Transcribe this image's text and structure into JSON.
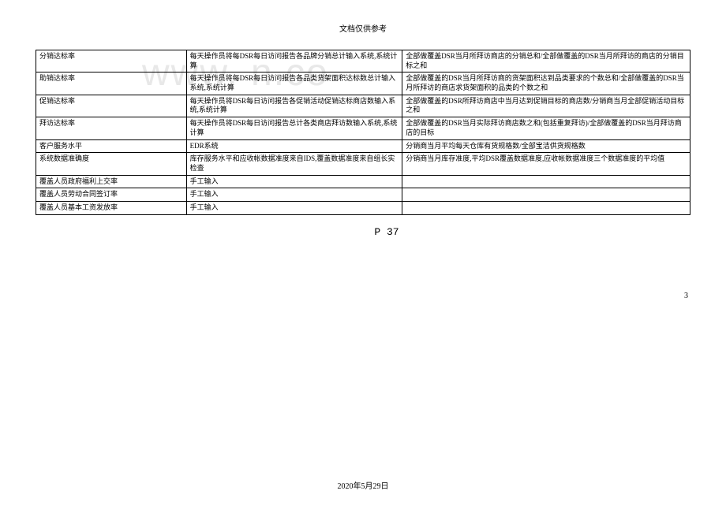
{
  "header": "文档仅供参考",
  "watermark": "www.             n.co",
  "rows": [
    {
      "c1": "分销达标率",
      "c2": "每天操作员将每DSR每日访问报告各品牌分销总计输入系统,系统计算",
      "c3": "全部做覆盖DSR当月所拜访商店的分销总和/全部做覆盖的DSR当月所拜访的商店的分销目标之和"
    },
    {
      "c1": "助销达标率",
      "c2": "每天操作员将每DSR每日访问报告各品类货架面积达标数总计输入系统,系统计算",
      "c3": "全部做覆盖的DSR当月所拜访商的货架面积达到品类要求的个数总和/全部做覆盖的DSR当月所拜访的商店求货架面积的品类的个数之和"
    },
    {
      "c1": "促销达标率",
      "c2": "每天操作员将DSR每日访问报告各促销活动促销达标商店数输入系统,系统计算",
      "c3": "全部做覆盖的DSR所拜访商店中当月达到促销目标的商店数/分销商当月全部促销活动目标之和"
    },
    {
      "c1": "拜访达标率",
      "c2": "每天操作员将DSR每日访问报告总计各类商店拜访数输入系统,系统计算",
      "c3": "全部做覆盖的DSR当月实际拜访商店数之和(包括重复拜访)/全部做覆盖的DSR当月拜访商店的目标"
    },
    {
      "c1": "客户服务水平",
      "c2": "EDR系统",
      "c3": "分销商当月平均每天仓库有货规格数/全部宝洁供货规格数"
    },
    {
      "c1": "系统数据准确度",
      "c2": "库存服务水平和应收帐数据准度来自IDS,覆盖数据准度来自组长实检查",
      "c3": "分销商当月库存准度,平均DSR覆盖数据准度,应收帐数据准度三个数据准度的平均值"
    },
    {
      "c1": "覆盖人员政府福利上交率",
      "c2": "手工输入",
      "c3": ""
    },
    {
      "c1": "覆盖人员劳动合同签订率",
      "c2": "手工输入",
      "c3": ""
    },
    {
      "c1": "覆盖人员基本工资发放率",
      "c2": "手工输入",
      "c3": ""
    }
  ],
  "pageLabel": "P 37",
  "pageNumber": "3",
  "dateFooter": "2020年5月29日"
}
